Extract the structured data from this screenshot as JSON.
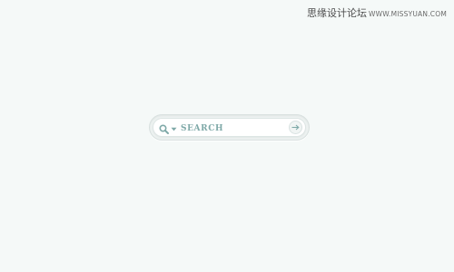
{
  "watermark": {
    "brand": "思缘设计论坛",
    "url": "WWW.MISSYUAN.COM"
  },
  "search": {
    "placeholder": "SEARCH",
    "search_icon": "search-icon",
    "dropdown_icon": "chevron-down-icon",
    "submit_icon": "arrow-right-icon"
  },
  "colors": {
    "background": "#f5f9f8",
    "accent": "#7fa9a8"
  }
}
